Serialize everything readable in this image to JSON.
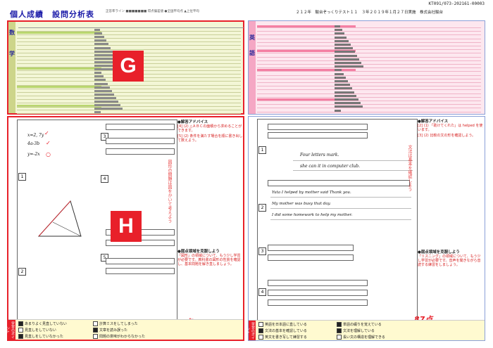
{
  "header": {
    "doc_id": "KT091/073-202161-00003",
    "title": "個人成績　設問分析表",
    "meta_left": "正答率ライン ■■■■■■■ 得点偏差値 ●全国平均点 ▲上位平均",
    "meta_right": "２１２年　駿台ぞっくりテスト１１　３年２０１９年１月２７日実施　株式会社駿台"
  },
  "labels": {
    "g": "G",
    "h": "H",
    "subject_left_top": "数",
    "subject_left_mid": "学",
    "subject_right_top": "英",
    "subject_right_mid": "語",
    "left_side_note": "図形の問題は図をかいて考えよう",
    "right_side_note": "文法は基本を確認しよう"
  },
  "left_advice": {
    "heading": "●解答アドバイス",
    "text1": "[4] (2) △ＡＢＣの面積から求めることができます。",
    "text2": "[5] (2) 条件を満たす場合を順に書き出して数えよう。",
    "heading2": "●弱点領域を克服しよう",
    "text3": "「図形」の領域について、もう少し学習が必要です。教科書の図形の性質を確認し、基本問題を解き直しましょう。",
    "score": "82点"
  },
  "right_advice": {
    "heading": "●解答アドバイス",
    "text1": "[2] (1) 「助けてくれた」は helped を使います。",
    "text2": "[3] (2) 比較の文の形を確認しよう。",
    "heading2": "●弱点領域を克服しよう",
    "text3": "「リスニング」の領域について、もう少し学習が必要です。音声を聞きながら音読する練習をしましょう。",
    "score": "87点"
  },
  "left_footer": {
    "tag": "学習のポイント",
    "items": [
      "あまりよく見直していない",
      "見直しをしていない",
      "見直しをしていなかった",
      "計算ミスをしてしまった",
      "文章を読み誤った",
      "問題の意味がわからなかった"
    ]
  },
  "right_footer": {
    "tag": "学習のポイント",
    "items": [
      "英語を日本語に直している",
      "文法の基本を確認している",
      "英文を書き写して練習する",
      "単語の綴りを覚えている",
      "文法を理解している",
      "長い文の構造を理解できる"
    ]
  },
  "handwriting": {
    "left1": "x=2, 7y",
    "left2": "4a-3b",
    "left3": "y=-2x",
    "r1": "Four letters mark.",
    "r2": "she can it in computer club.",
    "r3": "Yuta I helped by mother said Thank you.",
    "r4": "My mother was busy that day.",
    "r5": "I did some homework to help my mother."
  },
  "colors": {
    "accent": "#e8202a",
    "math_bg": "#f3f6d6",
    "eng_bg": "#fde7ef",
    "title": "#1a1aa8"
  }
}
